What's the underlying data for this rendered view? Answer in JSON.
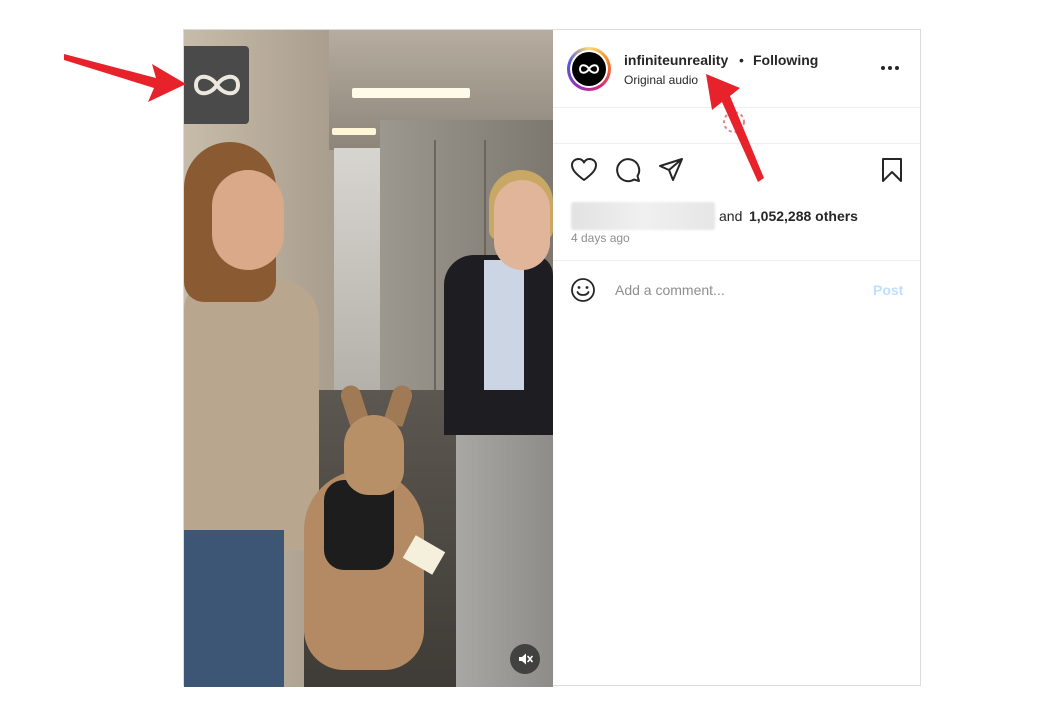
{
  "post": {
    "username": "infiniteunreality",
    "separator": "•",
    "follow_status": "Following",
    "audio_label": "Original audio",
    "more_icon": "more-horizontal-icon",
    "likes_prefix": "and",
    "likes_count": "1,052,288 others",
    "timestamp": "4 days ago",
    "comment_placeholder": "Add a comment...",
    "post_button": "Post"
  },
  "actions": {
    "like_icon": "heart-icon",
    "comment_icon": "comment-icon",
    "share_icon": "send-icon",
    "save_icon": "bookmark-icon"
  },
  "media": {
    "watermark_icon": "infinity-logo-icon",
    "mute_icon": "muted-speaker-icon"
  },
  "colors": {
    "annotation_arrow": "#e8222a",
    "post_disabled": "#c0dffd",
    "muted_text": "#8e8e8e"
  }
}
